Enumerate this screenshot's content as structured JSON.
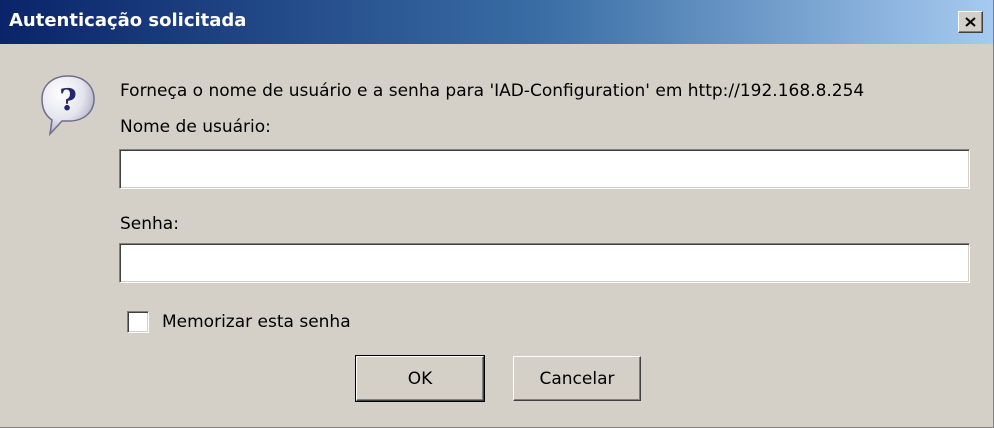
{
  "window": {
    "title": "Autenticação solicitada",
    "close_label": "Fechar"
  },
  "dialog": {
    "prompt": "Forneça o nome de usuário e a senha para 'IAD-Configuration' em http://192.168.8.254",
    "username_label": "Nome de usuário:",
    "username_value": "",
    "password_label": "Senha:",
    "password_value": "",
    "remember_label": "Memorizar esta senha",
    "remember_checked": false,
    "ok_label": "OK",
    "cancel_label": "Cancelar",
    "icon": "question-icon"
  },
  "colors": {
    "titlebar_start": "#0a246a",
    "titlebar_end": "#a6caf0",
    "dialog_background": "#d4d0c8",
    "title_text": "#ffffff"
  }
}
